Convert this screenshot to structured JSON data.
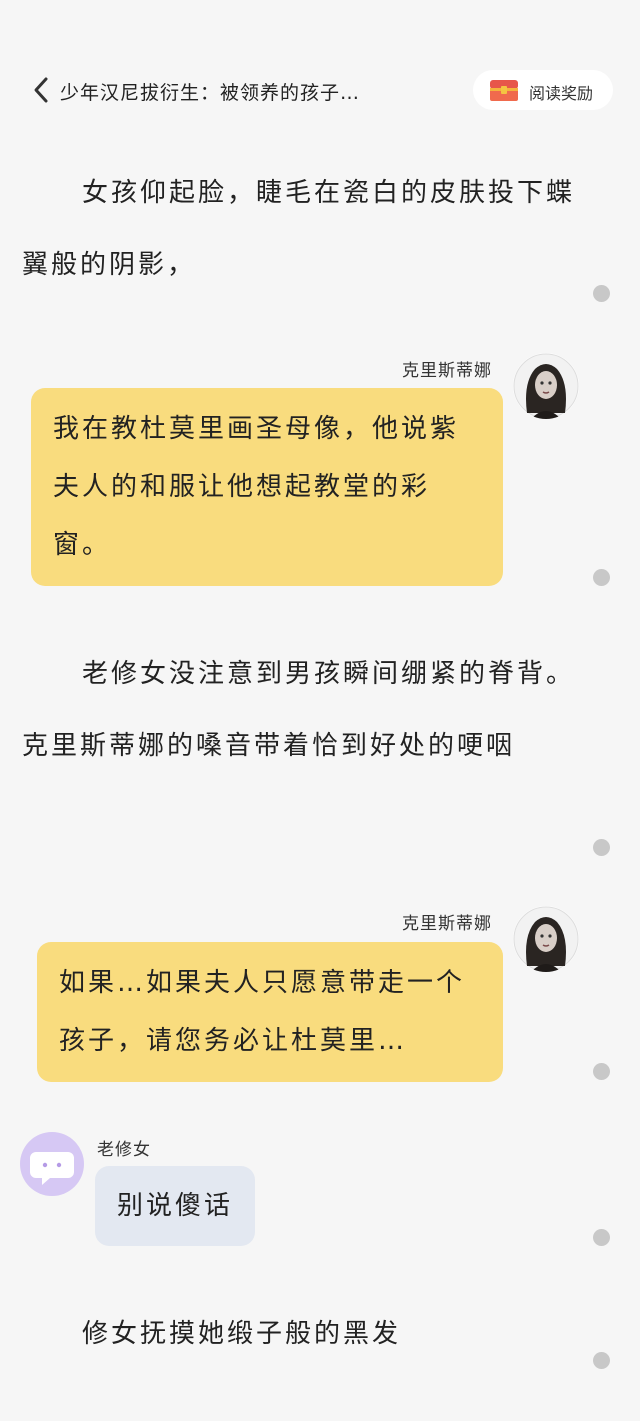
{
  "header": {
    "title": "少年汉尼拔衍生：被领养的孩子…",
    "reward_label": "阅读奖励"
  },
  "content": {
    "p1": "女孩仰起脸，睫毛在瓷白的皮肤投下蝶翼般的阴影，",
    "msg1": {
      "speaker": "克里斯蒂娜",
      "text": "我在教杜莫里画圣母像，他说紫夫人的和服让他想起教堂的彩窗。"
    },
    "p2": "老修女没注意到男孩瞬间绷紧的脊背。克里斯蒂娜的嗓音带着恰到好处的哽咽",
    "msg2": {
      "speaker": "克里斯蒂娜",
      "text": "如果…如果夫人只愿意带走一个孩子，请您务必让杜莫里…"
    },
    "msg3": {
      "speaker": "老修女",
      "text": "别说傻话"
    },
    "p3": "修女抚摸她缎子般的黑发"
  },
  "colors": {
    "background": "#f6f6f6",
    "bubble_yellow": "#f9dc7e",
    "bubble_blue": "#e3e8f1",
    "dot": "#c8c8c8",
    "avatar_purple": "#d6c8f4"
  },
  "icons": {
    "back": "chevron-left-icon",
    "reward": "treasure-chest-icon",
    "narrator_avatar": "chat-bubble-icon"
  }
}
